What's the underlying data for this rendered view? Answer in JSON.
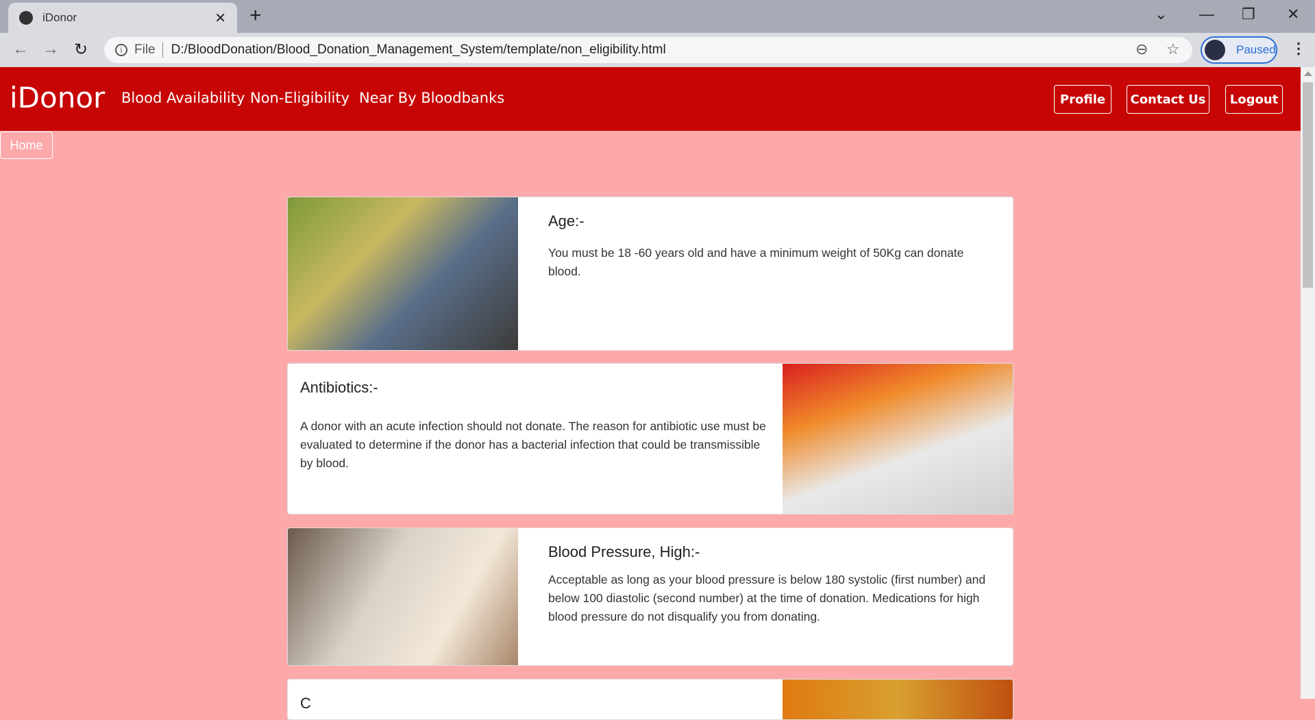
{
  "browser": {
    "tab_title": "iDonor",
    "file_label": "File",
    "url": "D:/BloodDonation/Blood_Donation_Management_System/template/non_eligibility.html",
    "profile_status": "Paused"
  },
  "navbar": {
    "brand": "iDonor",
    "links": [
      "Blood Availability",
      "Non-Eligibility",
      "Near By Bloodbanks"
    ],
    "buttons": [
      "Profile",
      "Contact Us",
      "Logout"
    ],
    "home": "Home",
    "color": "#c70505"
  },
  "cards": [
    {
      "title": "Age:-",
      "text": "You must be 18 -60 years old and have a minimum weight of 50Kg can donate blood.",
      "image": "two men sitting outdoors"
    },
    {
      "title": "Antibiotics:-",
      "text": "A donor with an acute infection should not donate. The reason for antibiotic use must be evaluated to determine if the donor has a bacterial infection that could be transmissible by blood.",
      "image": "antibiotic pills"
    },
    {
      "title": "Blood Pressure, High:-",
      "text": "Acceptable as long as your blood pressure is below 180 systolic (first number) and below 100 diastolic (second number) at the time of donation. Medications for high blood pressure do not disqualify you from donating.",
      "image": "blood pressure monitor"
    },
    {
      "title": "C",
      "text": "",
      "image": "cells"
    }
  ],
  "background": "#fda9aa"
}
